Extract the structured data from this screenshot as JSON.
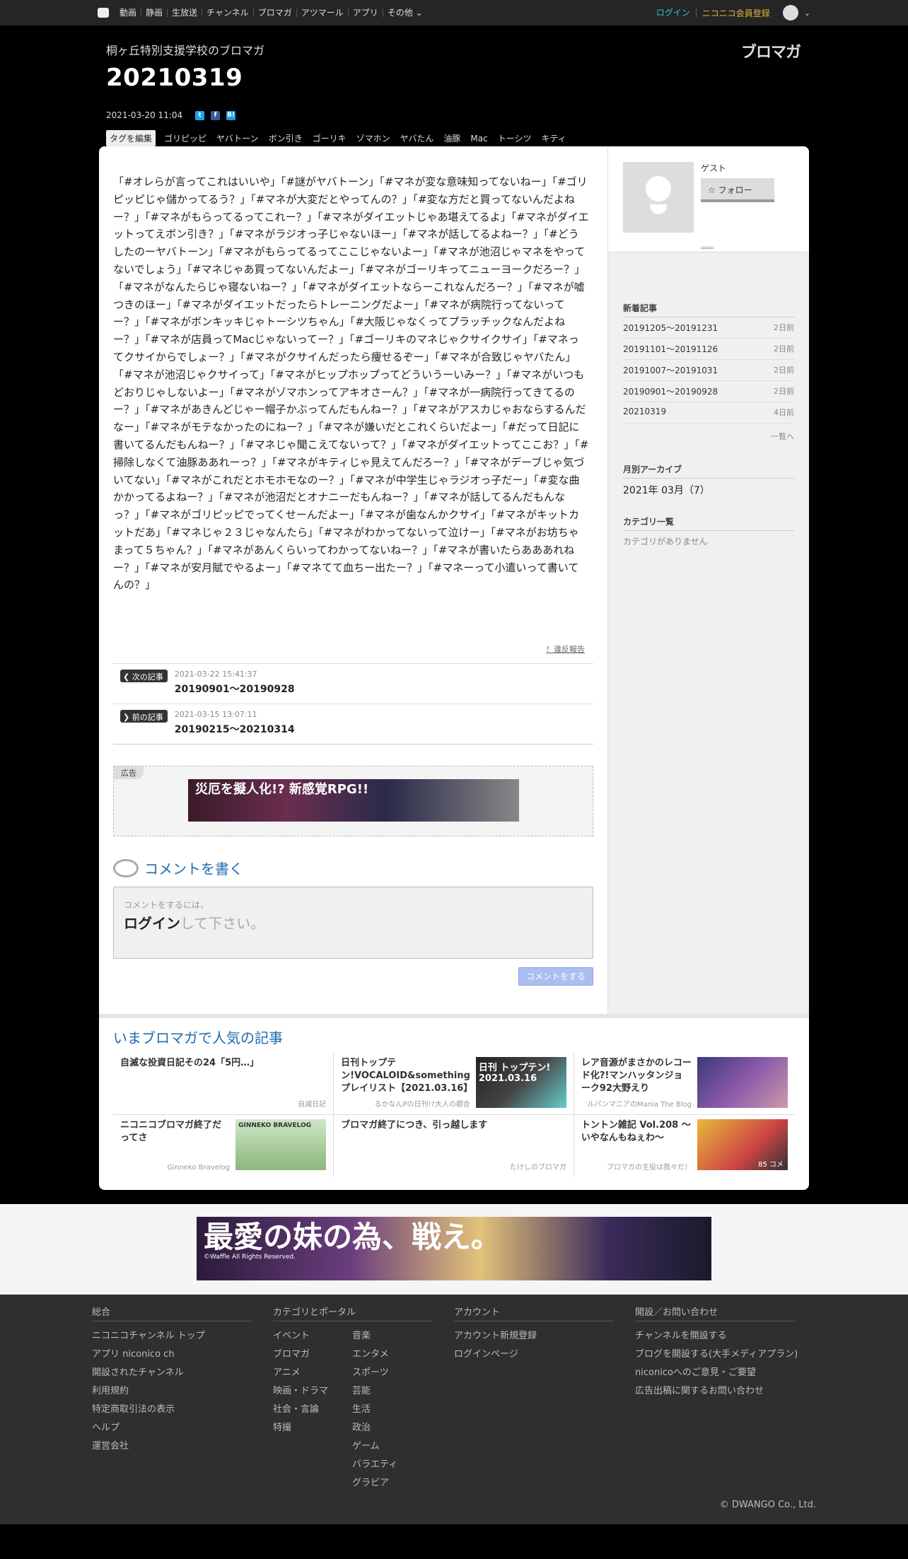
{
  "topnav": {
    "items": [
      "動画",
      "静画",
      "生放送",
      "チャンネル",
      "ブロマガ",
      "アツマール",
      "アプリ",
      "その他"
    ],
    "login": "ログイン",
    "register": "ニコニコ会員登録"
  },
  "header": {
    "channel": "桐ヶ丘特別支援学校のブロマガ",
    "title": "20210319",
    "brand": "ブロマガ",
    "date": "2021-03-20 11:04",
    "tag_edit": "タグを編集",
    "tags": [
      "ゴリピッピ",
      "ヤバトーン",
      "ボン引き",
      "ゴーリキ",
      "ゾマホン",
      "ヤバたん",
      "油豚",
      "Mac",
      "トーシツ",
      "キティ"
    ]
  },
  "article": {
    "body": "「#オレらが言ってこれはいいや」「#謎がヤバトーン」「#マネが変な意味知ってないねー」「#ゴリピッピじゃ儲かってるう？」「#マネが大変だとやってんの？」「#変な方だと買ってないんだよねー？」「#マネがもらってるってこれー？」「#マネがダイエットじゃあ堪えてるよ」「#マネがダイエットってえボン引き？」「#マネがラジオっ子じゃないほー」「#マネが話してるよねー？」「#どうしたのーヤバトーン」「#マネがもらってるってここじゃないよー」「#マネが池沼じゃマネをやってないでしょう」「#マネじゃあ買ってないんだよー」「#マネがゴーリキってニューヨークだろー？」「#マネがなんたらじゃ寝ないねー？」「#マネがダイエットならーこれなんだろー？」「#マネが嘘つきのほー」「#マネがダイエットだったらトレーニングだよー」「#マネが病院行ってないってー？」「#マネがボンキッキじゃトーシツちゃん」「#大阪じゃなくってプラッチックなんだよねー？」「#マネが店員ってMacじゃないってー？」「#ゴーリキのマネじゃクサイクサイ」「#マネってクサイからでしょー？」「#マネがクサイんだったら痩せるぞー」「#マネが合致じゃヤバたん」「#マネが池沼じゃクサイって」「#マネがヒップホップってどういうーいみー？」「#マネがいつもどおりじゃしないよー」「#マネがゾマホンってアキオさーん？」「#マネが一病院行ってきてるのー？」「#マネがあきんどじゃー帽子かぶってんだもんねー？」「#マネがアスカじゃおならするんだなー」「#マネがモテなかったのにねー？」「#マネが嫌いだとこれくらいだよー」「#だって日記に書いてるんだもんねー？」「#マネじゃ聞こえてないって？」「#マネがダイエットってここお？」「#掃除しなくて油豚ああれーっ？」「#マネがキティじゃ見えてんだろー？」「#マネがデーブじゃ気づいてない」「#マネがこれだとホモホモなのー？」「#マネが中学生じゃラジオっ子だー」「#変な曲かかってるよねー？」「#マネが池沼だとオナニーだもんねー？」「#マネが話してるんだもんなっ？」「#マネがゴリピッピでってくせーんだよー」「#マネが歯なんかクサイ」「#マネがキットカットだあ」「#マネじゃ２３じゃなんたら」「#マネがわかってないって泣けー」「#マネがお坊ちゃまって５ちゃん？」「#マネがあんくらいってわかってないねー？」「#マネが書いたらあああれねー？」「#マネが安月賦でやるよー」「#マネてて血ちー出たー？」「#マネーって小遣いって書いてんの？」",
    "report": "！違反報告",
    "next": {
      "badge": "次の記事",
      "date": "2021-03-22 15:41:37",
      "title": "20190901～20190928"
    },
    "prev": {
      "badge": "前の記事",
      "date": "2021-03-15 13:07:11",
      "title": "20190215～20210314"
    },
    "ad_label": "広告",
    "ad_text": "災厄を擬人化!? 新感覚RPG!!",
    "comment_title": "コメントを書く",
    "comment_hint": "コメントをするには、",
    "comment_login": "ログイン",
    "comment_suffix": "して下さい。",
    "comment_button": "コメントをする"
  },
  "sidebar": {
    "guest": "ゲスト",
    "follow": "フォロー",
    "recent_title": "新着記事",
    "recent": [
      {
        "title": "20191205～20191231",
        "ago": "2日前"
      },
      {
        "title": "20191101～20191126",
        "ago": "2日前"
      },
      {
        "title": "20191007～20191031",
        "ago": "2日前"
      },
      {
        "title": "20190901～20190928",
        "ago": "2日前"
      },
      {
        "title": "20210319",
        "ago": "4日前"
      }
    ],
    "more": "一覧へ",
    "archive_title": "月別アーカイブ",
    "archive_item": "2021年 03月（7）",
    "category_title": "カテゴリ一覧",
    "category_empty": "カテゴリがありません"
  },
  "popular": {
    "title": "いまブロマガで人気の記事",
    "items": [
      {
        "title": "自滅な投資日記その24「5円…」",
        "source": "自滅日記",
        "thumb": ""
      },
      {
        "title": "日刊トップテン!VOCALOID&something プレイリスト【2021.03.16】",
        "source": "るかなんPの日刊!?大人の都合",
        "thumb": "日刊 トップテン! 2021.03.16"
      },
      {
        "title": "レア音源がまさかのレコード化?!マンハッタンジョーク92大野えり",
        "source": "ルパンマニアのMania The Blog",
        "thumb": ""
      },
      {
        "title": "ニコニコブロマガ終了だってさ",
        "source": "Ginneko Bravelog",
        "thumb": "GINNEKO BRAVELOG"
      },
      {
        "title": "ブロマガ終了につき、引っ越します",
        "source": "たけしのブロマガ",
        "thumb": ""
      },
      {
        "title": "トントン雑記 Vol.208 ～いやなんもねぇわ～",
        "source": "ブロマガの主役は我々だ！",
        "thumb": "85 コメ"
      }
    ]
  },
  "bottom_ad": {
    "text": "最愛の妹の為、戦え。",
    "credit": "©Waffle All Rights Reserved."
  },
  "footer": {
    "col1_title": "総合",
    "col1": [
      "ニコニコチャンネル トップ",
      "アプリ niconico ch",
      "開設されたチャンネル",
      "利用規約",
      "特定商取引法の表示",
      "ヘルプ",
      "運営会社"
    ],
    "col2_title": "カテゴリとポータル",
    "col2a": [
      "イベント",
      "ブロマガ",
      "アニメ",
      "映画・ドラマ",
      "社会・言論",
      "特撮"
    ],
    "col2b": [
      "音楽",
      "エンタメ",
      "スポーツ",
      "芸能",
      "生活",
      "政治",
      "ゲーム",
      "バラエティ",
      "グラビア"
    ],
    "col3_title": "アカウント",
    "col3": [
      "アカウント新規登録",
      "ログインページ"
    ],
    "col4_title": "開設／お問い合わせ",
    "col4": [
      "チャンネルを開設する",
      "ブログを開設する(大手メディアプラン)",
      "niconicoへのご意見・ご要望",
      "広告出稿に関するお問い合わせ"
    ],
    "copyright": "© DWANGO Co., Ltd."
  },
  "colors": {
    "accent": "#1f6bb0",
    "login": "#34c3c8",
    "register": "#e6b23d"
  }
}
